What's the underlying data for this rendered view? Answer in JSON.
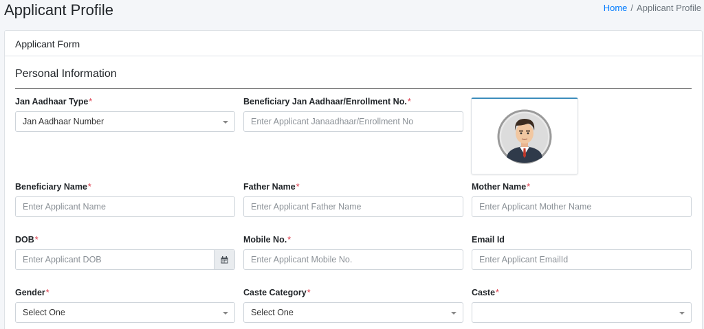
{
  "header": {
    "title": "Applicant Profile",
    "breadcrumb": {
      "home": "Home",
      "current": "Applicant Profile"
    }
  },
  "card": {
    "title": "Applicant Form",
    "section": "Personal Information"
  },
  "fields": {
    "jan_aadhaar_type": {
      "label": "Jan Aadhaar Type",
      "required": "*",
      "value": "Jan Aadhaar Number"
    },
    "enrollment_no": {
      "label": "Beneficiary Jan Aadhaar/Enrollment No.",
      "required": "*",
      "placeholder": "Enter Applicant Janaadhaar/Enrollment No"
    },
    "beneficiary_name": {
      "label": "Beneficiary Name",
      "required": "*",
      "placeholder": "Enter Applicant Name"
    },
    "father_name": {
      "label": "Father Name",
      "required": "*",
      "placeholder": "Enter Applicant Father Name"
    },
    "mother_name": {
      "label": "Mother Name",
      "required": "*",
      "placeholder": "Enter Applicant Mother Name"
    },
    "dob": {
      "label": "DOB",
      "required": "*",
      "placeholder": "Enter Applicant DOB"
    },
    "mobile_no": {
      "label": "Mobile No.",
      "required": "*",
      "placeholder": "Enter Applicant Mobile No."
    },
    "email_id": {
      "label": "Email Id",
      "placeholder": "Enter Applicant EmailId"
    },
    "gender": {
      "label": "Gender",
      "required": "*",
      "value": "Select One"
    },
    "caste_category": {
      "label": "Caste Category",
      "required": "*",
      "value": "Select One"
    },
    "caste": {
      "label": "Caste",
      "required": "*",
      "value": ""
    }
  },
  "icons": {
    "avatar": "avatar-icon",
    "calendar": "calendar-icon",
    "dropdown": "chevron-down-icon"
  },
  "colors": {
    "link": "#007bff",
    "required": "#dc3545",
    "photo_accent": "#3c8dbc"
  }
}
